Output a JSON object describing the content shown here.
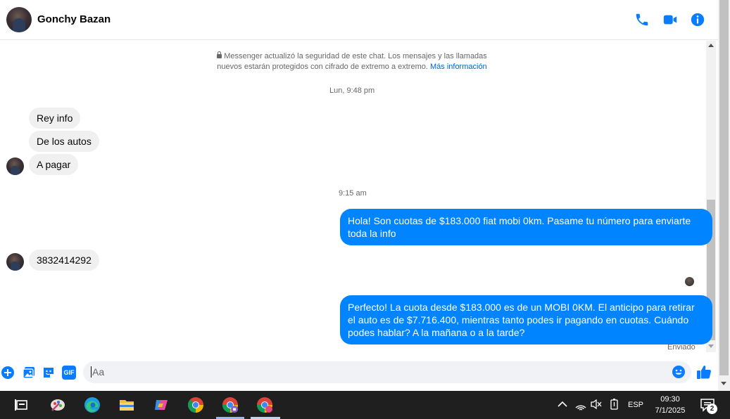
{
  "header": {
    "contact_name": "Gonchy Bazan"
  },
  "encryption_notice": {
    "line1": "Messenger actualizó la seguridad de este chat. Los mensajes y las llamadas",
    "line2": "nuevos estarán protegidos con cifrado de extremo a extremo.",
    "link": "Más información"
  },
  "timestamps": [
    "Lun, 9:48 pm",
    "9:15 am"
  ],
  "messages": [
    {
      "direction": "in",
      "text": "Rey info"
    },
    {
      "direction": "in",
      "text": "De los autos"
    },
    {
      "direction": "in",
      "text": "A pagar"
    },
    {
      "direction": "out",
      "text": "Hola! Son cuotas de $183.000 fiat mobi 0km. Pasame tu número para enviarte toda la info"
    },
    {
      "direction": "in",
      "text": "3832414292"
    },
    {
      "direction": "out",
      "text": "Perfecto! La cuota desde $183.000 es de un MOBI 0KM. El anticipo para retirar el auto es de $7.716.400, mientras tanto podes ir pagando en cuotas. Cuándo podes hablar? A la mañana o a la tarde?"
    }
  ],
  "status": {
    "sent_label": "Enviado"
  },
  "composer": {
    "placeholder": "Aa",
    "gif_label": "GIF"
  },
  "taskbar": {
    "language": "ESP",
    "time": "09:30",
    "date": "7/1/2025",
    "notification_count": "2"
  },
  "colors": {
    "accent": "#0084ff",
    "icon_blue": "#0a7cff",
    "incoming_bubble": "#f0f0f0",
    "taskbar": "#1f1f1f"
  }
}
